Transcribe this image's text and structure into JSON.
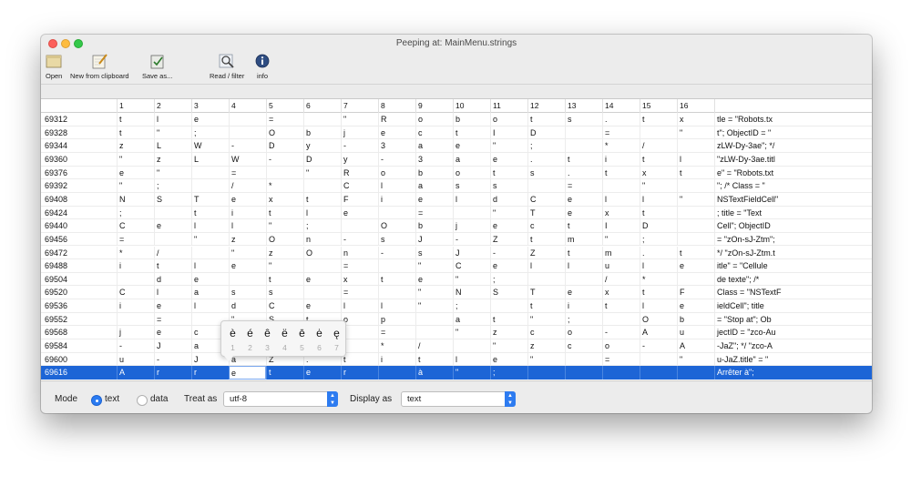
{
  "window": {
    "title": "Peeping at: MainMenu.strings"
  },
  "toolbar": {
    "open": "Open",
    "new_from_clipboard": "New from clipboard",
    "save_as": "Save as...",
    "read_filter": "Read / filter",
    "info": "info"
  },
  "columns": [
    "1",
    "2",
    "3",
    "4",
    "5",
    "6",
    "7",
    "8",
    "9",
    "10",
    "11",
    "12",
    "13",
    "14",
    "15",
    "16"
  ],
  "rows": [
    {
      "addr": "69312",
      "cells": [
        "t",
        "l",
        "e",
        "",
        "=",
        "",
        "\"",
        "R",
        "o",
        "b",
        "o",
        "t",
        "s",
        ".",
        "t",
        "x"
      ],
      "text": "tle = \"Robots.tx"
    },
    {
      "addr": "69328",
      "cells": [
        "t",
        "\"",
        ";",
        "",
        "O",
        "b",
        "j",
        "e",
        "c",
        "t",
        "I",
        "D",
        "",
        "=",
        "",
        "\""
      ],
      "text": "t\"; ObjectID = \""
    },
    {
      "addr": "69344",
      "cells": [
        "z",
        "L",
        "W",
        "-",
        "D",
        "y",
        "-",
        "3",
        "a",
        "e",
        "\"",
        ";",
        "",
        "*",
        "/",
        ""
      ],
      "text": "zLW-Dy-3ae\"; */"
    },
    {
      "addr": "69360",
      "cells": [
        "\"",
        "z",
        "L",
        "W",
        "-",
        "D",
        "y",
        "-",
        "3",
        "a",
        "e",
        ".",
        "t",
        "i",
        "t",
        "l"
      ],
      "text": "\"zLW-Dy-3ae.titl"
    },
    {
      "addr": "69376",
      "cells": [
        "e",
        "\"",
        "",
        "=",
        "",
        "\"",
        "R",
        "o",
        "b",
        "o",
        "t",
        "s",
        ".",
        "t",
        "x",
        "t"
      ],
      "text": "e\" = \"Robots.txt"
    },
    {
      "addr": "69392",
      "cells": [
        "\"",
        ";",
        "",
        "/",
        "*",
        "",
        "C",
        "l",
        "a",
        "s",
        "s",
        "",
        "=",
        "",
        "\"",
        ""
      ],
      "text": "\"; /* Class = \""
    },
    {
      "addr": "69408",
      "cells": [
        "N",
        "S",
        "T",
        "e",
        "x",
        "t",
        "F",
        "i",
        "e",
        "l",
        "d",
        "C",
        "e",
        "l",
        "l",
        "\""
      ],
      "text": "NSTextFieldCell\""
    },
    {
      "addr": "69424",
      "cells": [
        ";",
        "",
        "t",
        "i",
        "t",
        "l",
        "e",
        "",
        "=",
        "",
        "\"",
        "T",
        "e",
        "x",
        "t",
        ""
      ],
      "text": "; title = \"Text"
    },
    {
      "addr": "69440",
      "cells": [
        "C",
        "e",
        "l",
        "l",
        "\"",
        ";",
        "",
        "O",
        "b",
        "j",
        "e",
        "c",
        "t",
        "I",
        "D",
        ""
      ],
      "text": "Cell\"; ObjectID"
    },
    {
      "addr": "69456",
      "cells": [
        "=",
        "",
        "\"",
        "z",
        "O",
        "n",
        "-",
        "s",
        "J",
        "-",
        "Z",
        "t",
        "m",
        "\"",
        ";",
        ""
      ],
      "text": "= \"zOn-sJ-Ztm\";"
    },
    {
      "addr": "69472",
      "cells": [
        "*",
        "/",
        "",
        "\"",
        "z",
        "O",
        "n",
        "-",
        "s",
        "J",
        "-",
        "Z",
        "t",
        "m",
        ".",
        "t"
      ],
      "text": "*/ \"zOn-sJ-Ztm.t"
    },
    {
      "addr": "69488",
      "cells": [
        "i",
        "t",
        "l",
        "e",
        "\"",
        "",
        "=",
        "",
        "\"",
        "C",
        "e",
        "l",
        "l",
        "u",
        "l",
        "e"
      ],
      "text": "itle\" = \"Cellule"
    },
    {
      "addr": "69504",
      "cells": [
        "",
        "d",
        "e",
        "",
        "t",
        "e",
        "x",
        "t",
        "e",
        "\"",
        ";",
        "",
        "",
        "/",
        "*",
        ""
      ],
      "text": " de texte\"; /*"
    },
    {
      "addr": "69520",
      "cells": [
        "C",
        "l",
        "a",
        "s",
        "s",
        "",
        "=",
        "",
        "\"",
        "N",
        "S",
        "T",
        "e",
        "x",
        "t",
        "F"
      ],
      "text": "Class = \"NSTextF"
    },
    {
      "addr": "69536",
      "cells": [
        "i",
        "e",
        "l",
        "d",
        "C",
        "e",
        "l",
        "l",
        "\"",
        ";",
        "",
        "t",
        "i",
        "t",
        "l",
        "e"
      ],
      "text": "ieldCell\"; title"
    },
    {
      "addr": "69552",
      "cells": [
        "",
        "=",
        "",
        "\"",
        "S",
        "t",
        "o",
        "p",
        "",
        "a",
        "t",
        "\"",
        ";",
        "",
        "O",
        "b"
      ],
      "text": " = \"Stop at\"; Ob"
    },
    {
      "addr": "69568",
      "cells": [
        "j",
        "e",
        "c",
        "t",
        "I",
        "D",
        "",
        "=",
        "",
        "\"",
        "z",
        "c",
        "o",
        "-",
        "A",
        "u"
      ],
      "text": "jectID = \"zco-Au"
    },
    {
      "addr": "69584",
      "cells": [
        "-",
        "J",
        "a",
        "Z",
        "\"",
        ";",
        "",
        "*",
        "/",
        "",
        "\"",
        "z",
        "c",
        "o",
        "-",
        "A"
      ],
      "text": "-JaZ\"; */ \"zco-A"
    },
    {
      "addr": "69600",
      "cells": [
        "u",
        "-",
        "J",
        "a",
        "Z",
        ".",
        "t",
        "i",
        "t",
        "l",
        "e",
        "\"",
        "",
        "=",
        "",
        "\""
      ],
      "text": "u-JaZ.title\" = \""
    },
    {
      "addr": "69616",
      "cells": [
        "A",
        "r",
        "r",
        "e",
        "t",
        "e",
        "r",
        "",
        "à",
        "\"",
        ";",
        "",
        "",
        "",
        "",
        ""
      ],
      "text": "Arrêter à\";",
      "selected": true
    }
  ],
  "accent_popup": {
    "chars": [
      "è",
      "é",
      "ê",
      "ë",
      "ē",
      "ė",
      "ę"
    ],
    "numbers": [
      "1",
      "2",
      "3",
      "4",
      "5",
      "6",
      "7"
    ]
  },
  "bottom": {
    "mode_label": "Mode",
    "mode_text": "text",
    "mode_data": "data",
    "treat_as_label": "Treat as",
    "treat_as_value": "utf-8",
    "display_as_label": "Display as",
    "display_as_value": "text"
  },
  "colors": {
    "selection": "#1d65d6",
    "accent": "#2d7bf0"
  }
}
